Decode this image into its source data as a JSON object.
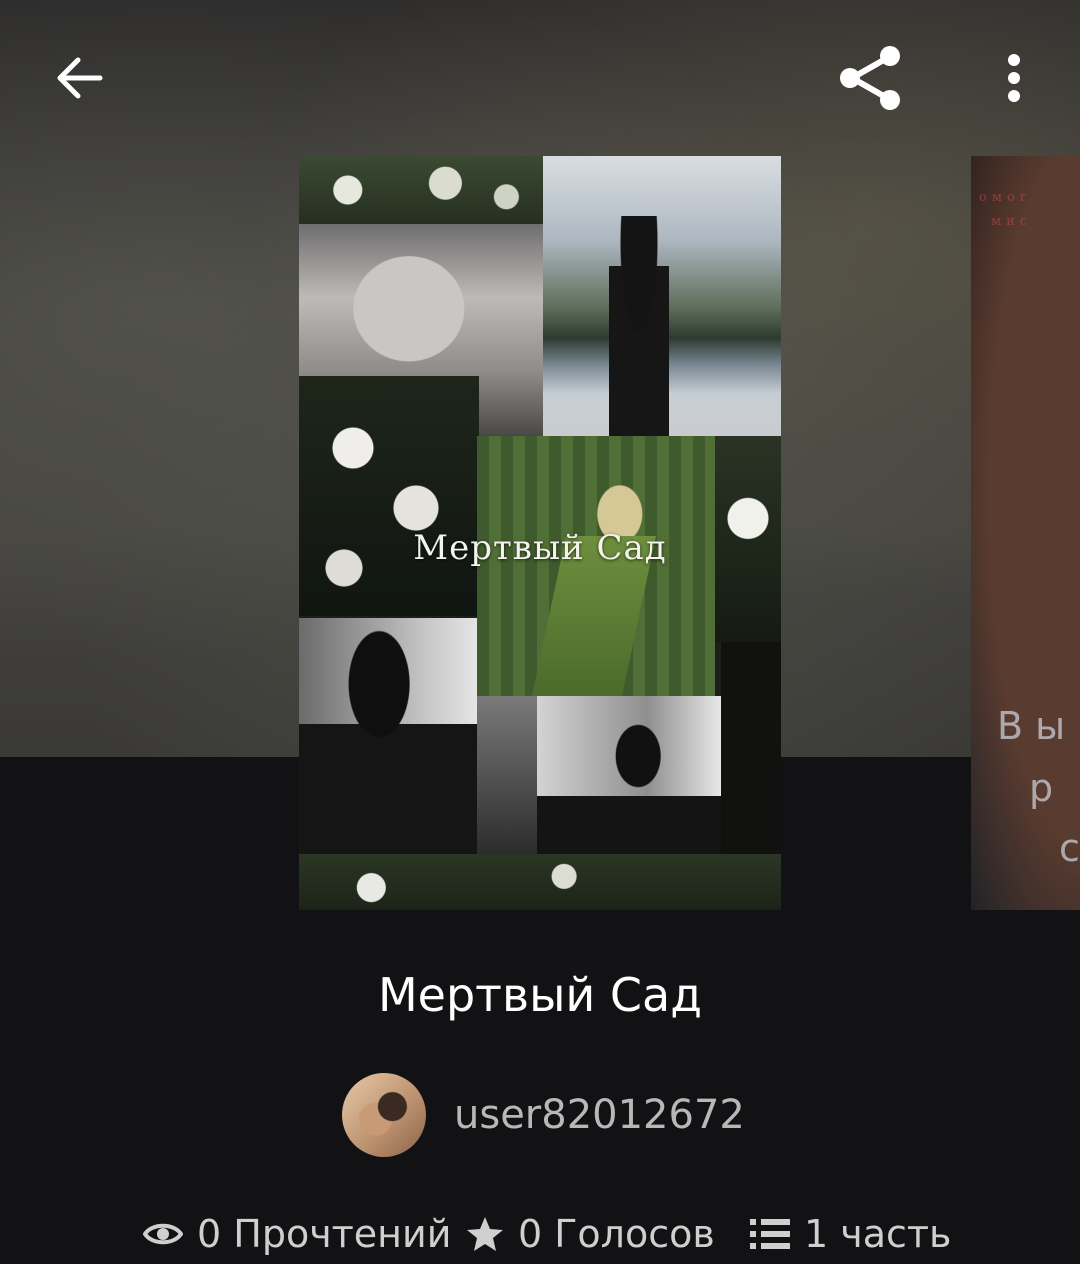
{
  "header": {
    "back_icon": "arrow-left-icon",
    "share_icon": "share-icon",
    "more_icon": "more-vertical-icon"
  },
  "cover": {
    "title_text": "Мертвый Сад"
  },
  "next_cover": {
    "line1": "В ы",
    "line2": "р",
    "line3": "с",
    "small1": "омог",
    "small2": "мис"
  },
  "story": {
    "title": "Мертвый Сад",
    "author": "user82012672"
  },
  "stats": {
    "reads": "0 Прочтений",
    "votes": "0 Голосов",
    "parts": "1 часть"
  },
  "colors": {
    "background": "#121113",
    "text_primary": "#ffffff",
    "text_secondary": "#b8b8b8"
  }
}
